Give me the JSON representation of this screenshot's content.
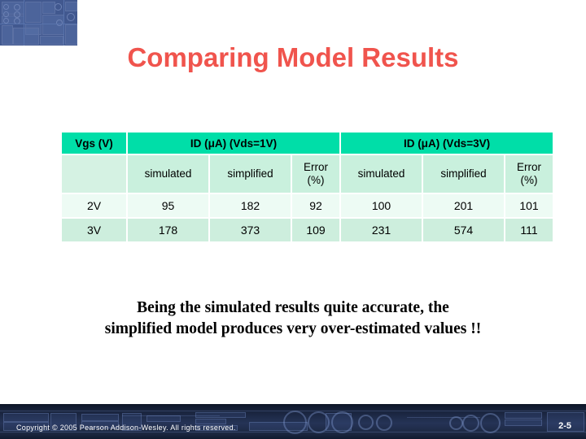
{
  "slide": {
    "title": "Comparing Model Results",
    "title_color": "#f0544d"
  },
  "decorations": {
    "corner_image_name": "circuit-board-graphic",
    "corner_image_color": "#41588f"
  },
  "table": {
    "header_bg": "#00dea8",
    "subheader_bg": "#c9f0dd",
    "row_a_bg": "#edfbf4",
    "row_b_bg": "#cdeedd",
    "group_headers": [
      "Vgs (V)",
      "ID (μA) (Vds=1V)",
      "ID (μA) (Vds=3V)"
    ],
    "sub_headers": [
      "",
      "simulated",
      "simplified",
      "Error\n(%)",
      "simulated",
      "simplified",
      "Error\n(%)"
    ],
    "sub_headers_display": {
      "blank": "",
      "sim1": "simulated",
      "simp1": "simplified",
      "err1_line1": "Error",
      "err1_line2": "(%)",
      "sim2": "simulated",
      "simp2": "simplified",
      "err2_line1": "Error",
      "err2_line2": "(%)"
    },
    "rows": [
      {
        "vgs": "2V",
        "sim1": "95",
        "simp1": "182",
        "err1": "92",
        "sim2": "100",
        "simp2": "201",
        "err2": "101"
      },
      {
        "vgs": "3V",
        "sim1": "178",
        "simp1": "373",
        "err1": "109",
        "sim2": "231",
        "simp2": "574",
        "err2": "111"
      }
    ]
  },
  "conclusion": {
    "line1": "Being the simulated results quite accurate, the",
    "line2": "simplified model produces very over-estimated values !!"
  },
  "footer": {
    "copyright": "Copyright © 2005 Pearson Addison-Wesley. All rights reserved.",
    "page_number": "2-5"
  }
}
